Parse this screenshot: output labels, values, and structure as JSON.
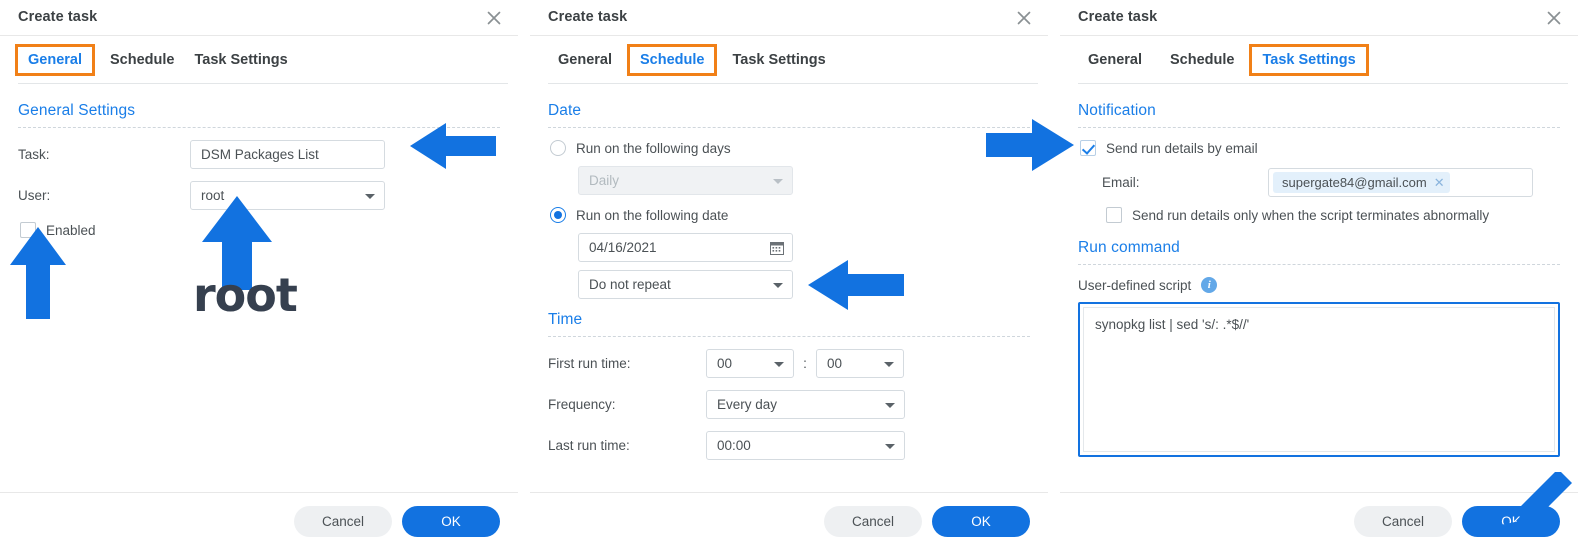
{
  "accent": {
    "blue": "#1272e0",
    "link_blue": "#1a7ee8",
    "orange_highlight": "#f18017",
    "arrow_blue": "#1272e0",
    "annotation_text": "#36404f"
  },
  "panels": [
    {
      "title": "Create task",
      "close_icon": "close-icon",
      "tabs": [
        {
          "label": "General",
          "active": true,
          "highlighted": true
        },
        {
          "label": "Schedule",
          "active": false,
          "highlighted": false
        },
        {
          "label": "Task Settings",
          "active": false,
          "highlighted": false
        }
      ],
      "section_title": "General Settings",
      "fields": {
        "task_label": "Task:",
        "task_value": "DSM Packages List",
        "user_label": "User:",
        "user_value": "root",
        "enabled_label": "Enabled",
        "enabled_checked": false
      },
      "footer": {
        "cancel": "Cancel",
        "ok": "OK"
      }
    },
    {
      "title": "Create task",
      "close_icon": "close-icon",
      "tabs": [
        {
          "label": "General",
          "active": false,
          "highlighted": false
        },
        {
          "label": "Schedule",
          "active": true,
          "highlighted": true
        },
        {
          "label": "Task Settings",
          "active": false,
          "highlighted": false
        }
      ],
      "date_section_title": "Date",
      "time_section_title": "Time",
      "date": {
        "run_days_label": "Run on the following days",
        "run_days_selected": false,
        "daily_value": "Daily",
        "daily_disabled": true,
        "run_date_label": "Run on the following date",
        "run_date_selected": true,
        "date_value": "04/16/2021",
        "repeat_value": "Do not repeat",
        "calendar_icon": "calendar-icon"
      },
      "time": {
        "first_run_label": "First run time:",
        "first_run_hour": "00",
        "first_run_separator": ":",
        "first_run_minute": "00",
        "frequency_label": "Frequency:",
        "frequency_value": "Every day",
        "last_run_label": "Last run time:",
        "last_run_value": "00:00"
      },
      "footer": {
        "cancel": "Cancel",
        "ok": "OK"
      }
    },
    {
      "title": "Create task",
      "close_icon": "close-icon",
      "tabs": [
        {
          "label": "General",
          "active": false,
          "highlighted": false
        },
        {
          "label": "Schedule",
          "active": false,
          "highlighted": false
        },
        {
          "label": "Task Settings",
          "active": true,
          "highlighted": true
        }
      ],
      "notification_section_title": "Notification",
      "notification": {
        "send_email_label": "Send run details by email",
        "send_email_checked": true,
        "email_label": "Email:",
        "email_tag": "supergate84@gmail.com",
        "email_tag_remove_icon": "close-small-icon",
        "abnormal_label": "Send run details only when the script terminates abnormally",
        "abnormal_checked": false
      },
      "run_command_section_title": "Run command",
      "run_command": {
        "script_label": "User-defined script",
        "info_icon": "info-icon",
        "script_value": "synopkg list | sed 's/: .*$//'"
      },
      "footer": {
        "cancel": "Cancel",
        "ok": "OK"
      }
    }
  ],
  "annotations": {
    "root_text": "root",
    "arrows": [
      {
        "name": "arrow-enabled-checkbox",
        "direction": "up"
      },
      {
        "name": "arrow-user-dropdown",
        "direction": "up"
      },
      {
        "name": "arrow-task-name-field",
        "direction": "left"
      },
      {
        "name": "arrow-repeat-dropdown",
        "direction": "left"
      },
      {
        "name": "arrow-send-email-checkbox",
        "direction": "right"
      },
      {
        "name": "arrow-ok-button",
        "direction": "down-left"
      }
    ]
  }
}
